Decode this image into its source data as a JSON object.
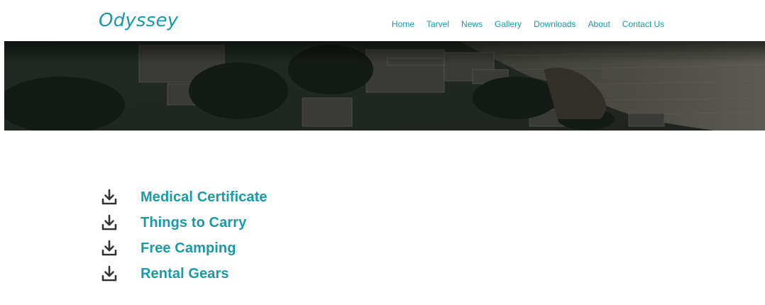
{
  "header": {
    "logo": "Odyssey",
    "nav": [
      "Home",
      "Tarvel",
      "News",
      "Gallery",
      "Downloads",
      "About",
      "Contact Us"
    ]
  },
  "downloads": {
    "items": [
      {
        "label": "Medical Certificate",
        "icon": "download-icon"
      },
      {
        "label": "Things to Carry",
        "icon": "download-icon"
      },
      {
        "label": "Free Camping",
        "icon": "download-icon"
      },
      {
        "label": "Rental Gears",
        "icon": "download-icon"
      }
    ]
  },
  "colors": {
    "accent": "#1a9aa6",
    "icon": "#333333"
  }
}
